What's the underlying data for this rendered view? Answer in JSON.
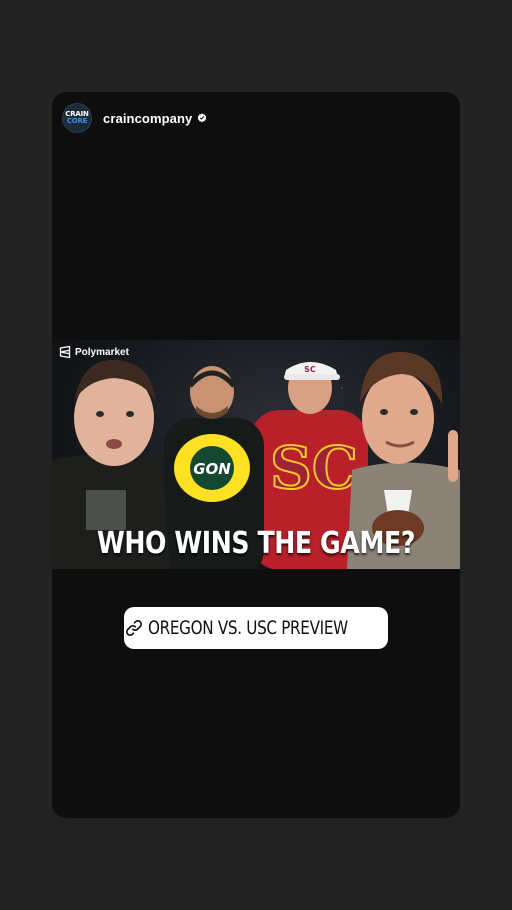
{
  "story": {
    "account": {
      "username": "craincompany",
      "verified": true,
      "avatar_line1": "CRAIN",
      "avatar_line2": "CORE"
    },
    "media": {
      "sponsor_label": "Polymarket",
      "headline": "WHO WINS THE GAME?",
      "logos": {
        "left": "O",
        "right": "SC"
      },
      "colors": {
        "oregon_green": "#154733",
        "oregon_yellow": "#fee123",
        "usc_cardinal": "#9d2235",
        "usc_gold": "#ffc72c"
      }
    },
    "link_sticker": {
      "label": "OREGON VS. USC PREVIEW",
      "icon": "link-icon"
    }
  }
}
